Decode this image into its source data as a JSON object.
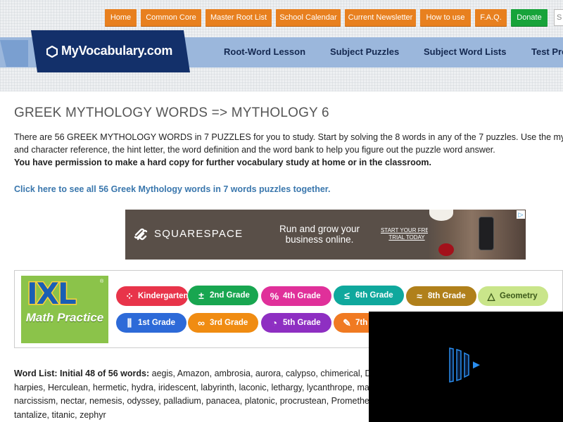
{
  "top_nav": {
    "items": [
      "Home",
      "Common Core",
      "Master Root List",
      "School Calendar",
      "Current Newsletter",
      "How to use",
      "F.A.Q.",
      "Donate"
    ],
    "search_placeholder": "S"
  },
  "brand": {
    "name": "MyVocabulary.com"
  },
  "main_nav": {
    "items": [
      "Root-Word Lesson",
      "Subject Puzzles",
      "Subject Word Lists",
      "Test Pre"
    ]
  },
  "page": {
    "title": "GREEK MYTHOLOGY WORDS => MYTHOLOGY 6",
    "intro_line1": "There are 56 GREEK MYTHOLOGY WORDS in 7 PUZZLES for you to study. Start by solving the 8 words in any of the 7 puzzles. Use the my",
    "intro_line2": "and character reference, the hint letter, the word definition and the word bank to help you figure out the puzzle word answer.",
    "permission": "You have permission to make a hard copy for further vocabulary study at home or in the classroom.",
    "see_all_link": "Click here to see all 56 Greek Mythology words in 7 words puzzles together."
  },
  "ad": {
    "brand": "SQUARESPACE",
    "headline": "Run and grow your business online.",
    "cta": "START YOUR FREE TRIAL TODAY",
    "choices_icon": "adchoices-icon"
  },
  "ixl": {
    "logo_word": "IXL",
    "tagline": "Math Practice",
    "grades_row1": [
      {
        "label": "Kindergarten",
        "color": "#e8344a",
        "icon": "dots-icon"
      },
      {
        "label": "2nd Grade",
        "color": "#18a650",
        "icon": "plus-minus-icon"
      },
      {
        "label": "4th Grade",
        "color": "#e0309a",
        "icon": "percent-icon"
      },
      {
        "label": "6th Grade",
        "color": "#0fa89d",
        "icon": "less-equal-icon"
      },
      {
        "label": "8th Grade",
        "color": "#b0801b",
        "icon": "approx-icon"
      },
      {
        "label": "Geometry",
        "color": "#c9e58a",
        "icon": "triangle-icon"
      }
    ],
    "grades_row2": [
      {
        "label": "1st Grade",
        "color": "#2d6ad8",
        "icon": "ruler-icon"
      },
      {
        "label": "3rd Grade",
        "color": "#f08c12",
        "icon": "infinity-icon"
      },
      {
        "label": "5th Grade",
        "color": "#8e2fc2",
        "icon": "pie-icon"
      },
      {
        "label": "7th",
        "color": "#f07a22",
        "icon": "pencil-icon"
      }
    ]
  },
  "word_list": {
    "prefix": "Word List: Initial 48 of 56 words:",
    "line1": "aegis, Amazon, ambrosia, aurora, calypso, chimerical, D",
    "line2": "harpies, Herculean, hermetic, hydra, iridescent, labyrinth, laconic, lethargy, lycanthrope, ma",
    "line3": "narcissism, nectar, nemesis, odyssey, palladium, panacea, platonic, procrustean, Promethe",
    "line4": "tantalize, titanic, zephyr"
  },
  "video": {
    "icon": "video-player-logo-icon"
  }
}
